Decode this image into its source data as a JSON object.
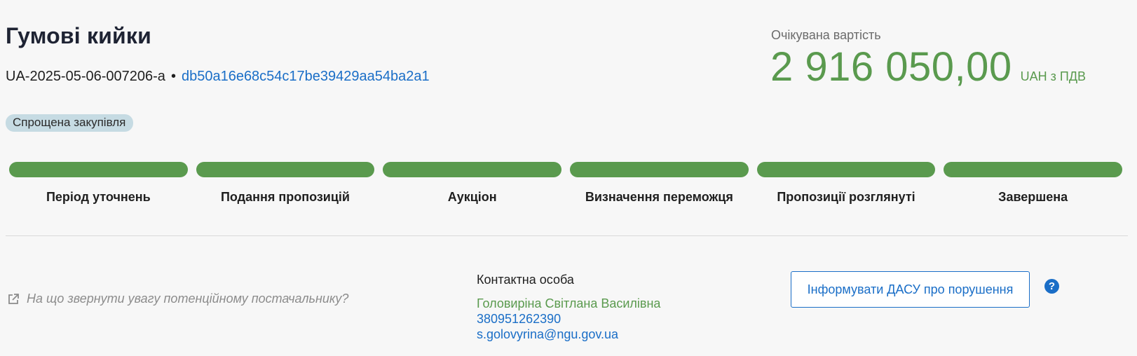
{
  "tender": {
    "title": "Гумові кийки",
    "id": "UA-2025-05-06-007206-a",
    "separator": "•",
    "hash": "db50a16e68c54c17be39429aa54ba2a1",
    "procedure_badge": "Спрощена закупівля"
  },
  "value": {
    "label": "Очікувана вартість",
    "amount": "2 916 050,00",
    "currency": "UAH з ПДВ"
  },
  "stepper": {
    "steps": [
      {
        "label": "Період уточнень",
        "completed": true
      },
      {
        "label": "Подання пропозицій",
        "completed": true
      },
      {
        "label": "Аукціон",
        "completed": true
      },
      {
        "label": "Визначення переможця",
        "completed": true
      },
      {
        "label": "Пропозиції розглянуті",
        "completed": true
      },
      {
        "label": "Завершена",
        "completed": true
      }
    ],
    "completed_color": "#5a9a4e"
  },
  "advice": {
    "text": "На що звернути увагу потенційному постачальнику?",
    "icon": "external-link-icon"
  },
  "contact": {
    "title": "Контактна особа",
    "name": "Головиріна Світлана Василівна",
    "phone": "380951262390",
    "email": "s.golovyrina@ngu.gov.ua"
  },
  "actions": {
    "report_label": "Інформувати ДАСУ про порушення",
    "help_icon": "help-icon",
    "help_glyph": "?"
  },
  "colors": {
    "accent_green": "#5a9a4e",
    "link_blue": "#1a6ec7",
    "badge_bg": "#c6dbe3"
  }
}
